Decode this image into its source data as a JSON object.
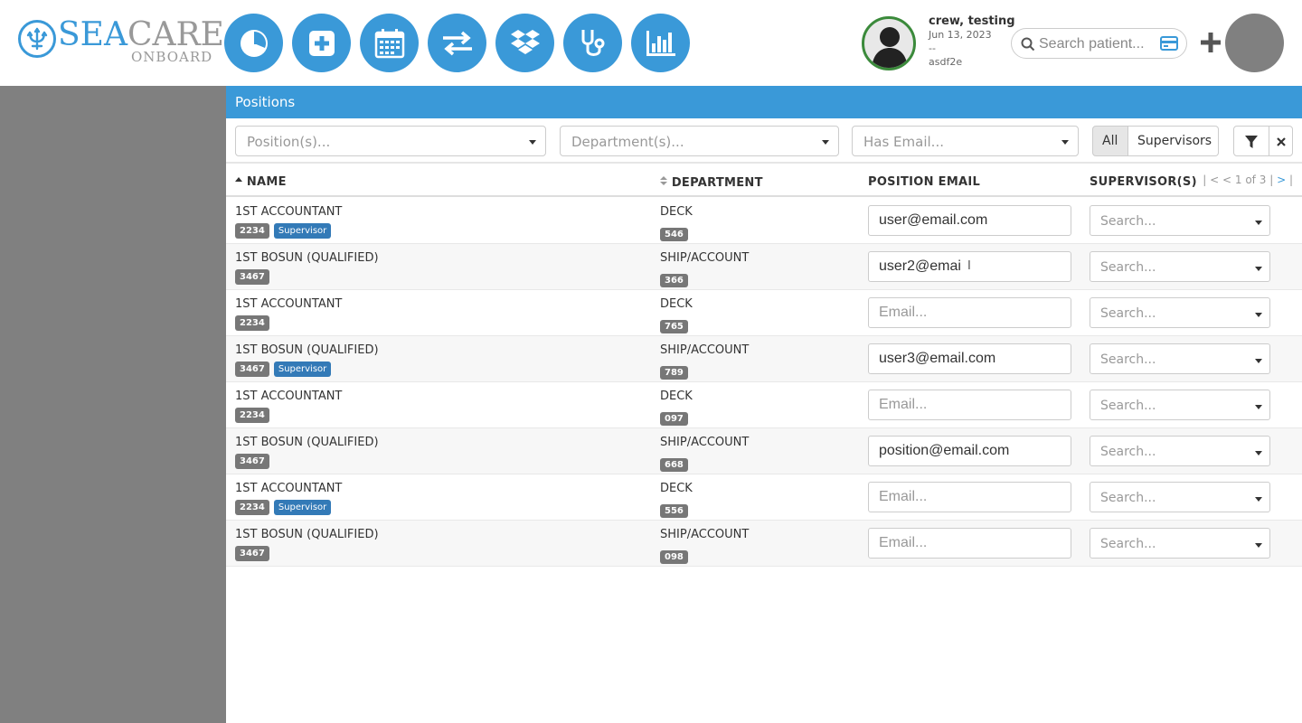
{
  "brand": {
    "name_part1": "SEA",
    "name_part2": "CARE",
    "subtitle": "ONBOARD"
  },
  "nav_icons": [
    "pie-chart-icon",
    "medical-plus-icon",
    "calendar-icon",
    "transfer-arrows-icon",
    "dropbox-icon",
    "stethoscope-icon",
    "bar-chart-icon"
  ],
  "user": {
    "name": "crew, testing",
    "date": "Jun 13, 2023",
    "dash": "--",
    "code": "asdf2e"
  },
  "search": {
    "placeholder": "Search patient..."
  },
  "page": {
    "title": "Positions"
  },
  "filters": {
    "positions_placeholder": "Position(s)...",
    "department_placeholder": "Department(s)...",
    "has_email_placeholder": "Has Email...",
    "all_label": "All",
    "supervisors_label": "Supervisors"
  },
  "table": {
    "headers": {
      "name": "NAME",
      "department": "DEPARTMENT",
      "email": "POSITION EMAIL",
      "supervisors": "SUPERVISOR(S)"
    },
    "pager": {
      "first": "| <",
      "prev": "<",
      "info": "1 of 3",
      "next": ">",
      "last": "|"
    },
    "email_placeholder": "Email...",
    "supervisor_placeholder": "Search...",
    "rows": [
      {
        "name": "1ST ACCOUNTANT",
        "code": "2234",
        "supervisor_badge": "Supervisor",
        "department": "DECK",
        "dept_code": "546",
        "email": "user@email.com"
      },
      {
        "name": "1ST BOSUN (QUALIFIED)",
        "code": "3467",
        "supervisor_badge": "",
        "department": "SHIP/ACCOUNT",
        "dept_code": "366",
        "email": "user2@emai"
      },
      {
        "name": "1ST ACCOUNTANT",
        "code": "2234",
        "supervisor_badge": "",
        "department": "DECK",
        "dept_code": "765",
        "email": ""
      },
      {
        "name": "1ST BOSUN (QUALIFIED)",
        "code": "3467",
        "supervisor_badge": "Supervisor",
        "department": "SHIP/ACCOUNT",
        "dept_code": "789",
        "email": "user3@email.com"
      },
      {
        "name": "1ST ACCOUNTANT",
        "code": "2234",
        "supervisor_badge": "",
        "department": "DECK",
        "dept_code": "097",
        "email": ""
      },
      {
        "name": "1ST BOSUN (QUALIFIED)",
        "code": "3467",
        "supervisor_badge": "",
        "department": "SHIP/ACCOUNT",
        "dept_code": "668",
        "email": "position@email.com"
      },
      {
        "name": "1ST ACCOUNTANT",
        "code": "2234",
        "supervisor_badge": "Supervisor",
        "department": "DECK",
        "dept_code": "556",
        "email": ""
      },
      {
        "name": "1ST BOSUN (QUALIFIED)",
        "code": "3467",
        "supervisor_badge": "",
        "department": "SHIP/ACCOUNT",
        "dept_code": "098",
        "email": ""
      }
    ]
  },
  "colors": {
    "primary": "#3a99d8",
    "sidebar": "#808080",
    "badge_gray": "#777777",
    "badge_blue": "#337ab7"
  }
}
